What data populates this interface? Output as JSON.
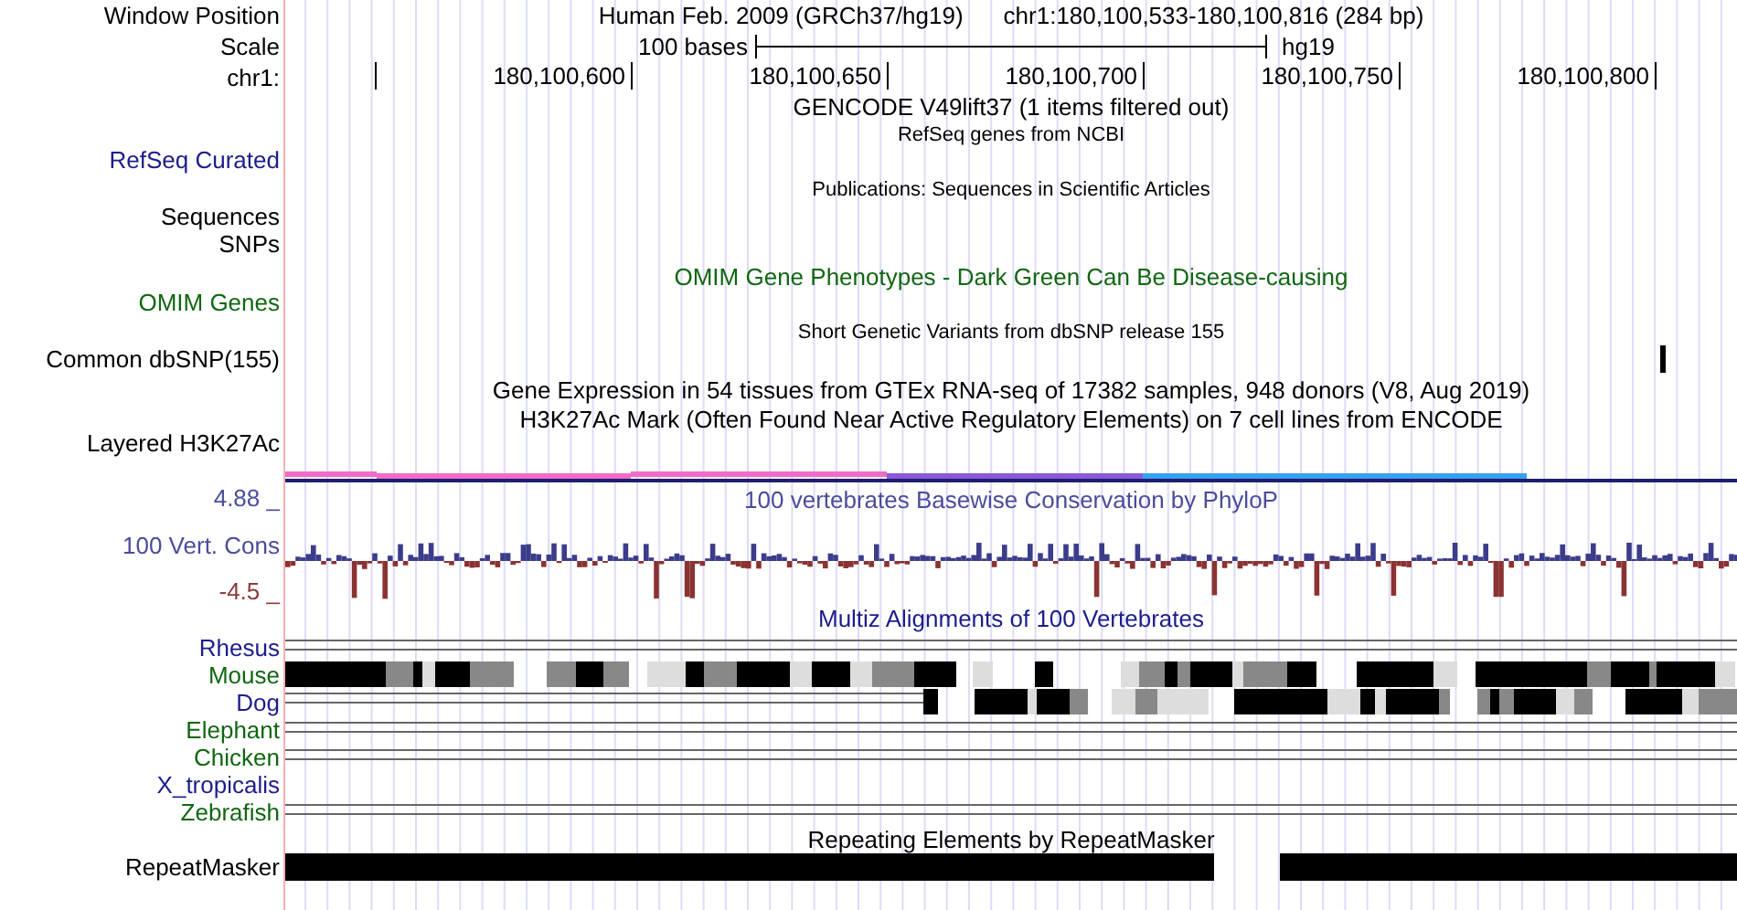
{
  "header": {
    "assembly": "Human Feb. 2009 (GRCh37/hg19)",
    "position": "chr1:180,100,533-180,100,816 (284 bp)",
    "scale_text": "100 bases",
    "db": "hg19",
    "ticks": [
      "180,100,600",
      "180,100,650",
      "180,100,700",
      "180,100,750",
      "180,100,800"
    ]
  },
  "side_labels": [
    {
      "text": "Window Position",
      "color": "#000000"
    },
    {
      "text": "Scale",
      "color": "#000000"
    },
    {
      "text": "chr1:",
      "color": "#000000"
    },
    {
      "text": "RefSeq Curated",
      "color": "#1c1c8c"
    },
    {
      "text": "Sequences",
      "color": "#000000"
    },
    {
      "text": "SNPs",
      "color": "#000000"
    },
    {
      "text": "OMIM Genes",
      "color": "#116611"
    },
    {
      "text": "Common dbSNP(155)",
      "color": "#000000"
    },
    {
      "text": "Layered H3K27Ac",
      "color": "#000000"
    },
    {
      "text": "4.88 _",
      "color": "#4b4b9b"
    },
    {
      "text": "100 Vert. Cons",
      "color": "#4b4b9b"
    },
    {
      "text": "-4.5 _",
      "color": "#8b3a3a"
    },
    {
      "text": "Rhesus",
      "color": "#1c1c8c"
    },
    {
      "text": "Mouse",
      "color": "#116611"
    },
    {
      "text": "Dog",
      "color": "#1c1c8c"
    },
    {
      "text": "Elephant",
      "color": "#116611"
    },
    {
      "text": "Chicken",
      "color": "#116611"
    },
    {
      "text": "X_tropicalis",
      "color": "#1c1c8c"
    },
    {
      "text": "Zebrafish",
      "color": "#116611"
    },
    {
      "text": "RepeatMasker",
      "color": "#000000"
    }
  ],
  "tracks": [
    {
      "kind": "gencode",
      "title": "GENCODE V49lift37 (1 items filtered out)",
      "small": false,
      "color": "#000000"
    },
    {
      "kind": "refseq",
      "title": "RefSeq genes from NCBI",
      "small": true,
      "color": "#000000"
    },
    {
      "kind": "publications",
      "title": "Publications: Sequences in Scientific Articles",
      "small": true,
      "color": "#000000"
    },
    {
      "kind": "omim",
      "title": "OMIM Gene Phenotypes - Dark Green Can Be Disease-causing",
      "small": false,
      "color": "#116611"
    },
    {
      "kind": "dbsnp",
      "title": "Short Genetic Variants from dbSNP release 155",
      "small": true,
      "color": "#000000"
    },
    {
      "kind": "gtex",
      "title": "Gene Expression in 54 tissues from GTEx RNA-seq of 17382 samples, 948 donors (V8, Aug 2019)",
      "small": false,
      "color": "#000000"
    },
    {
      "kind": "layered",
      "title": "H3K27Ac Mark (Often Found Near Active Regulatory Elements) on 7 cell lines from ENCODE",
      "small": false,
      "color": "#000000"
    },
    {
      "kind": "phylop",
      "title": "100 vertebrates Basewise Conservation by PhyloP",
      "small": false,
      "color": "#4b4b9b"
    },
    {
      "kind": "multiz",
      "title": "Multiz Alignments of 100 Vertebrates",
      "small": false,
      "color": "#1c1c8c",
      "rows": [
        {
          "kind": "lines"
        },
        {
          "kind": "blocks"
        },
        {
          "kind": "partial"
        },
        {
          "kind": "lines"
        },
        {
          "kind": "lines"
        },
        {
          "kind": "empty"
        },
        {
          "kind": "lines"
        }
      ]
    },
    {
      "kind": "repeatmasker",
      "title": "Repeating Elements by RepeatMasker",
      "small": false,
      "color": "#000000"
    }
  ]
}
